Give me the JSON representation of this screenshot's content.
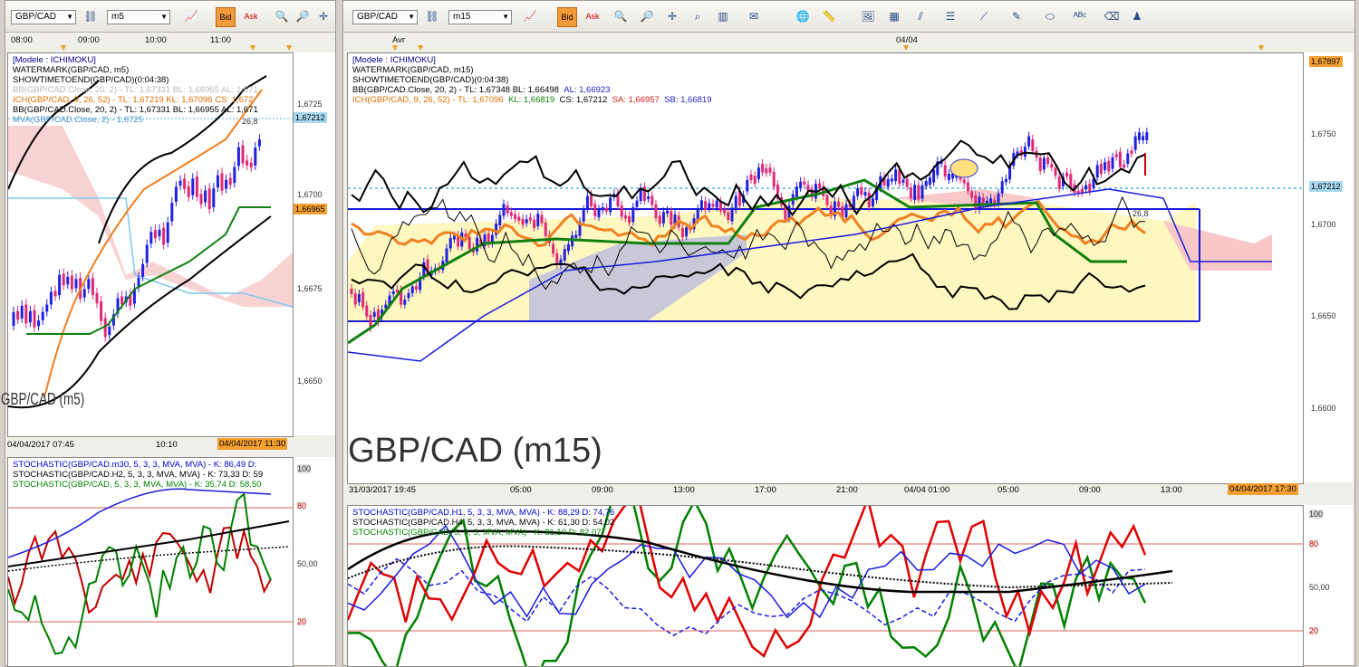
{
  "left_window": {
    "symbol": "GBP/CAD",
    "timeframe": "m5",
    "bid_label": "Bid",
    "ask_label": "Ask",
    "top_times": [
      "08:00",
      "09:00",
      "10:00",
      "11:00"
    ],
    "legend": [
      {
        "text": "[Modele : ICHIMOKU]",
        "color": "#00008b"
      },
      {
        "text": "WATERMARK(GBP/CAD, m5)",
        "color": "#000000"
      },
      {
        "text": "SHOWTIMETOEND(GBP/CAD)(0:04:38)",
        "color": "#000000"
      },
      {
        "text": "BB(GBP/CAD.Close, 20, 2)  -  TL: 1,67331  BL: 1,66955  AL: 1,671",
        "color": "#bbbbbb"
      },
      {
        "text": "ICH(GBP/CAD, 9, 26, 52)  -  TL: 1,67219  KL: 1,67096  CS: 1,672",
        "color": "#e07000"
      },
      {
        "text": "BB(GBP/CAD.Close, 20, 2)  -  TL: 1,67331  BL: 1,66955  AL: 1,671",
        "color": "#000000"
      },
      {
        "text": "MVA(GBP/CAD.Close, 2)  -  1,6725",
        "color": "#4a90c8"
      }
    ],
    "price_ticks": [
      "1,6725",
      "1,6700",
      "1,6675",
      "1,6650"
    ],
    "current_price_tag": "1,67212",
    "orange_price_tag": "1,66965",
    "watermark": "GBP/CAD (m5)",
    "bottom_start": "04/04/2017 07:45",
    "bottom_mid": "10:10",
    "bottom_end": "04/04/2017 11:30",
    "marker_label": "26,8",
    "osc_legend": [
      {
        "text": "STOCHASTIC(GBP/CAD.m30, 5, 3, 3, MVA, MVA)  -  K: 86,49  D:",
        "color": "#0000cc"
      },
      {
        "text": "STOCHASTIC(GBP/CAD.H2, 5, 3, 3, MVA, MVA)  -  K: 73,33  D: 59",
        "color": "#000000"
      },
      {
        "text": "STOCHASTIC(GBP/CAD, 5, 3, 3, MVA, MVA)  -  K: 35,74  D: 58,50",
        "color": "#008000"
      }
    ],
    "osc_ticks": [
      "100",
      "80",
      "50,00",
      "20"
    ]
  },
  "right_window": {
    "symbol": "GBP/CAD",
    "timeframe": "m15",
    "bid_label": "Bid",
    "ask_label": "Ask",
    "top_labels": [
      "Avr",
      "04/04"
    ],
    "legend": [
      {
        "text": "[Modele : ICHIMOKU]",
        "color": "#00008b"
      },
      {
        "text": "WATERMARK(GBP/CAD, m15)",
        "color": "#000000"
      },
      {
        "text": "SHOWTIMETOEND(GBP/CAD)(0:04:38)",
        "color": "#000000"
      }
    ],
    "bb_legend": {
      "name": "BB(GBP/CAD.Close, 20, 2)  -  TL: 1,67348  BL: 1,66498",
      "al": "AL: 1,66923"
    },
    "ich_legend": {
      "name": "ICH(GBP/CAD, 9, 26, 52)  -  TL: 1,67096",
      "kl": "KL: 1,66819",
      "cs": "CS: 1,67212",
      "sa": "SA: 1,66957",
      "sb": "SB: 1,66819"
    },
    "price_ticks": [
      "1,6750",
      "1,6700",
      "1,6650",
      "1,6600"
    ],
    "top_price_tag": "1,67897",
    "current_price_tag": "1,67212",
    "watermark": "GBP/CAD (m15)",
    "marker_label": "26,8",
    "bottom_times": [
      "31/03/2017 19:45",
      "05:00",
      "09:00",
      "13:00",
      "17:00",
      "21:00",
      "04/04 01:00",
      "05:00",
      "09:00",
      "13:00"
    ],
    "bottom_end": "04/04/2017 17:30",
    "osc_legend": [
      {
        "text": "STOCHASTIC(GBP/CAD.H1, 5, 3, 3, MVA, MVA)  -  K: 88,29  D: 74,76",
        "color": "#0000cc"
      },
      {
        "text": "STOCHASTIC(GBP/CAD.H4, 5, 3, 3, MVA, MVA)  -  K: 61,30  D: 54,02",
        "color": "#000000"
      },
      {
        "text": "STOCHASTIC(GBP/CAD, 5, 3, 3, MVA, MVA)  -  K: 81,10  D: 82,07",
        "color": "#008000"
      }
    ],
    "osc_ticks": [
      "100",
      "80",
      "50,00",
      "20"
    ]
  },
  "colors": {
    "bull_candle": "#2020e0",
    "bear_candle": "#e0287a",
    "tenkan": "#f08020",
    "kijun": "#108010",
    "bollinger": "#000000",
    "kumo_bull": "#fff7c0",
    "kumo_bear": "#f8c8c8",
    "channel": "#1a1adc",
    "current_price_line": "#50b8e0",
    "tag_orange": "#f5a030"
  }
}
